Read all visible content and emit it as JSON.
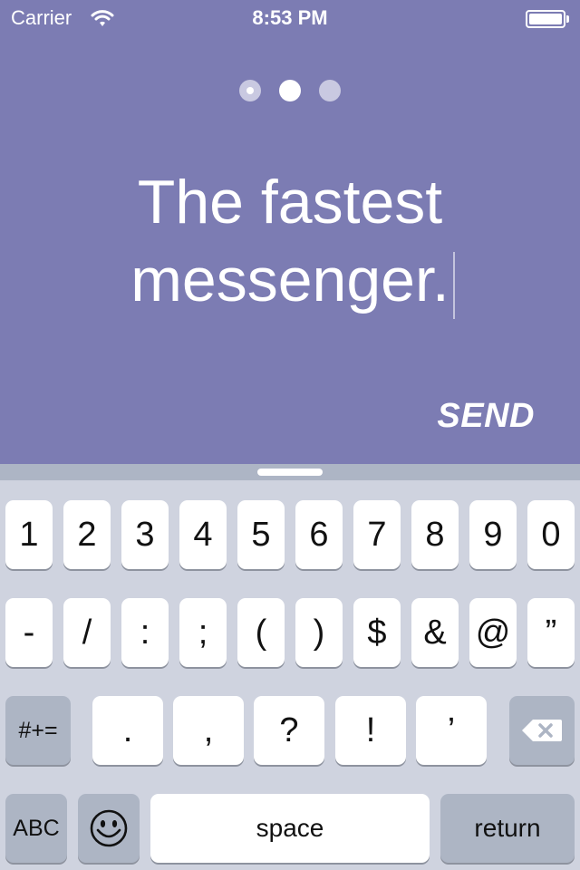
{
  "status_bar": {
    "carrier": "Carrier",
    "time": "8:53 PM"
  },
  "pager": {
    "page_count": 3,
    "current_page": 2
  },
  "headline": {
    "line1": "The fastest",
    "line2": "messenger."
  },
  "send_label": "SEND",
  "keyboard": {
    "row1": [
      "1",
      "2",
      "3",
      "4",
      "5",
      "6",
      "7",
      "8",
      "9",
      "0"
    ],
    "row2": [
      "-",
      "/",
      ":",
      ";",
      "(",
      ")",
      "$",
      "&",
      "@",
      "”"
    ],
    "row3": {
      "toggle": "#+=",
      "keys": [
        ".",
        ",",
        "?",
        "!",
        "’"
      ],
      "delete_icon": "backspace-icon"
    },
    "row4": {
      "abc": "ABC",
      "emoji_icon": "emoji-icon",
      "space": "space",
      "return": "return"
    }
  },
  "colors": {
    "background": "#7c7cb3",
    "keyboard": "#cfd3df",
    "dark_key": "#adb5c4"
  }
}
